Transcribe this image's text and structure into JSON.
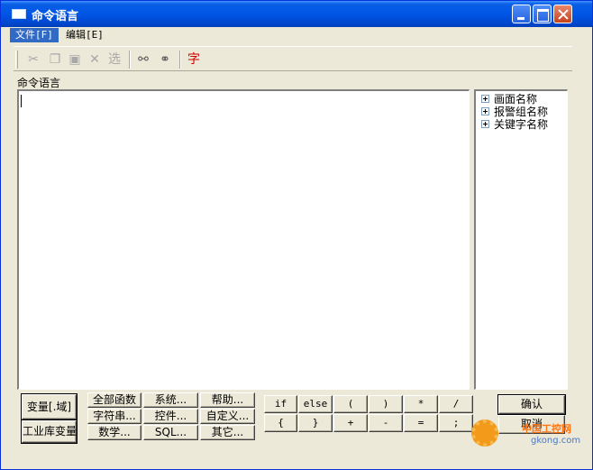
{
  "window": {
    "title": "命令语言",
    "title_icon": "window-icon",
    "controls": {
      "minimize": "minimize-icon",
      "maximize": "maximize-icon",
      "close": "close-icon"
    },
    "colors": {
      "titlebar": "#0055e5",
      "face": "#ece9d8",
      "menu_highlight": "#316ac5"
    }
  },
  "menu": {
    "file": "文件[F]",
    "edit": "编辑[E]"
  },
  "toolbar": {
    "cut_icon": "scissors-icon",
    "copy_icon": "copy-icon",
    "paste_icon": "paste-icon",
    "delete_icon": "delete-x-icon",
    "select_label": "选",
    "find_icon": "binoculars-icon",
    "replace_icon": "replace-icon",
    "font_label": "字"
  },
  "editor": {
    "label": "命令语言",
    "content": ""
  },
  "tree": {
    "items": [
      "画面名称",
      "报警组名称",
      "关键字名称"
    ]
  },
  "buttons": {
    "variable": "变量[.域]",
    "library_variable": "工业库变量",
    "functions": [
      "全部函数",
      "系统...",
      "帮助...",
      "字符串...",
      "控件...",
      "自定义...",
      "数学...",
      "SQL...",
      "其它..."
    ],
    "operators": [
      "if",
      "else",
      "(",
      ")",
      "*",
      "/",
      "{",
      "}",
      "+",
      "-",
      "=",
      ";"
    ],
    "ok": "确认",
    "cancel": "取消"
  },
  "watermark": {
    "line1": "中国工控网",
    "line2": "gkong.com"
  }
}
